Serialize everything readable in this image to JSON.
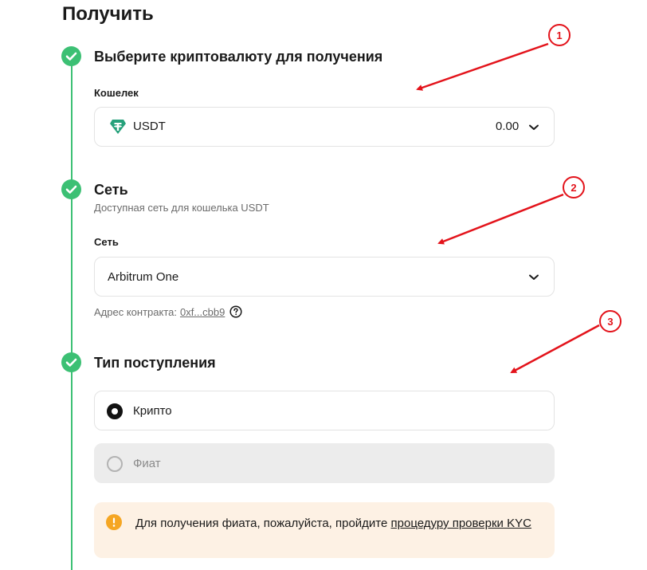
{
  "page": {
    "title": "Получить"
  },
  "steps": [
    {
      "title": "Выберите криптовалюту для получения"
    },
    {
      "title": "Сеть",
      "subtitle": "Доступная сеть для кошелька USDT"
    },
    {
      "title": "Тип поступления"
    }
  ],
  "wallet": {
    "label": "Кошелек",
    "currency": "USDT",
    "balance": "0.00",
    "icon": "tether-icon"
  },
  "network": {
    "label": "Сеть",
    "selected": "Arbitrum One",
    "contract_label": "Адрес контракта:",
    "contract_address": "0xf...cbb9"
  },
  "receipt_type": {
    "options": [
      {
        "label": "Крипто",
        "selected": true,
        "disabled": false
      },
      {
        "label": "Фиат",
        "selected": false,
        "disabled": true
      }
    ]
  },
  "notice": {
    "text": "Для получения фиата, пожалуйста, пройдите ",
    "link": "процедуру проверки KYC",
    "icon": "warning-icon"
  },
  "annotations": [
    "1",
    "2",
    "3"
  ],
  "colors": {
    "accent_green": "#3cc074",
    "tether_green": "#26a17b",
    "annotation_red": "#e3131b",
    "notice_bg": "#fdf1e4",
    "warning_orange": "#f5a623",
    "disabled_bg": "#ececec"
  }
}
